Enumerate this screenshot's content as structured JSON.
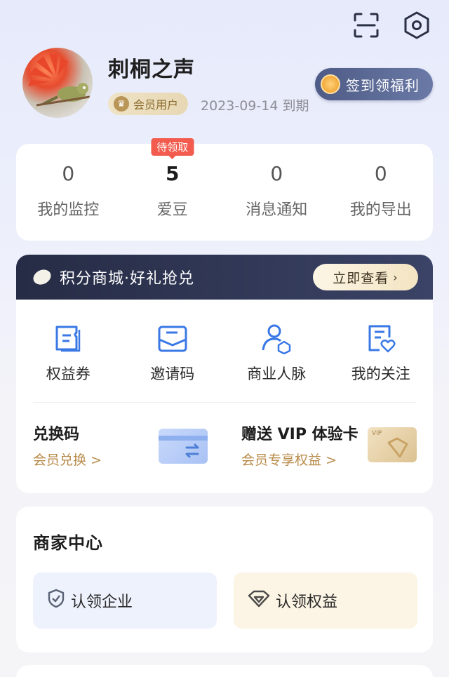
{
  "header": {
    "scan_icon": "scan-icon",
    "settings_icon": "hexagon-settings-icon"
  },
  "profile": {
    "username": "刺桐之声",
    "member_label": "会员用户",
    "expire_text": "2023-09-14 到期",
    "checkin_label": "签到领福利"
  },
  "stats": [
    {
      "value": "0",
      "label": "我的监控"
    },
    {
      "value": "5",
      "label": "爱豆",
      "badge": "待领取"
    },
    {
      "value": "0",
      "label": "消息通知"
    },
    {
      "value": "0",
      "label": "我的导出"
    }
  ],
  "mall": {
    "banner_text": "积分商城·好礼抢兑",
    "view_button": "立即查看",
    "grid": [
      {
        "label": "权益券",
        "icon": "coupon-icon"
      },
      {
        "label": "邀请码",
        "icon": "envelope-icon"
      },
      {
        "label": "商业人脉",
        "icon": "person-network-icon"
      },
      {
        "label": "我的关注",
        "icon": "heart-doc-icon"
      }
    ],
    "redeem": {
      "title": "兑换码",
      "subtitle": "会员兑换",
      "subtitle_suffix": ">"
    },
    "vip": {
      "title": "赠送 VIP 体验卡",
      "subtitle": "会员专享权益",
      "subtitle_suffix": ">",
      "card_text": "VIP"
    }
  },
  "merchant": {
    "title": "商家中心",
    "claim_company": "认领企业",
    "claim_rights": "认领权益"
  },
  "colors": {
    "accent_gold": "#b88b4a",
    "banner_dark": "#262c45",
    "badge_red": "#f25b4d",
    "icon_blue": "#3a78e6"
  }
}
